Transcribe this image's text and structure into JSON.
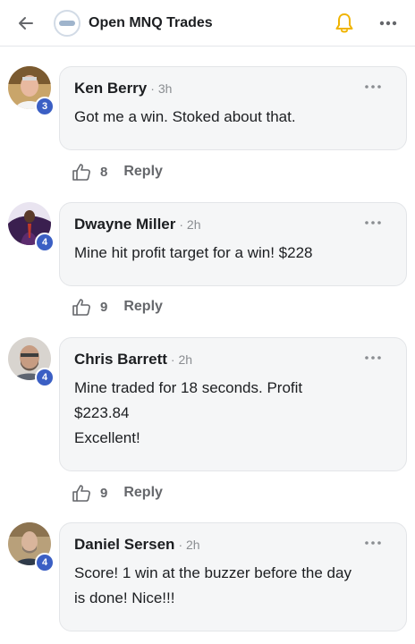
{
  "header": {
    "title": "Open MNQ Trades",
    "back_icon": "arrow-left-icon",
    "bell_icon": "bell-icon",
    "more_icon": "more-horizontal-icon",
    "accent_color": "#3b5fc4",
    "bell_color": "#f0b400"
  },
  "comments": [
    {
      "author": "Ken Berry",
      "time": "· 3h",
      "level": "3",
      "lines": [
        "Got me a win. Stoked about that."
      ],
      "likes": "8",
      "reply_label": "Reply"
    },
    {
      "author": "Dwayne Miller",
      "time": "· 2h",
      "level": "4",
      "lines": [
        "Mine hit profit target for a win! $228"
      ],
      "likes": "9",
      "reply_label": "Reply"
    },
    {
      "author": "Chris Barrett",
      "time": "· 2h",
      "level": "4",
      "lines": [
        "Mine traded for 18 seconds. Profit",
        "$223.84",
        "Excellent!"
      ],
      "likes": "9",
      "reply_label": "Reply"
    },
    {
      "author": "Daniel Sersen",
      "time": "· 2h",
      "level": "4",
      "lines": [
        "Score! 1 win at the buzzer before the day",
        "is done! Nice!!!"
      ],
      "likes": "",
      "reply_label": ""
    }
  ]
}
